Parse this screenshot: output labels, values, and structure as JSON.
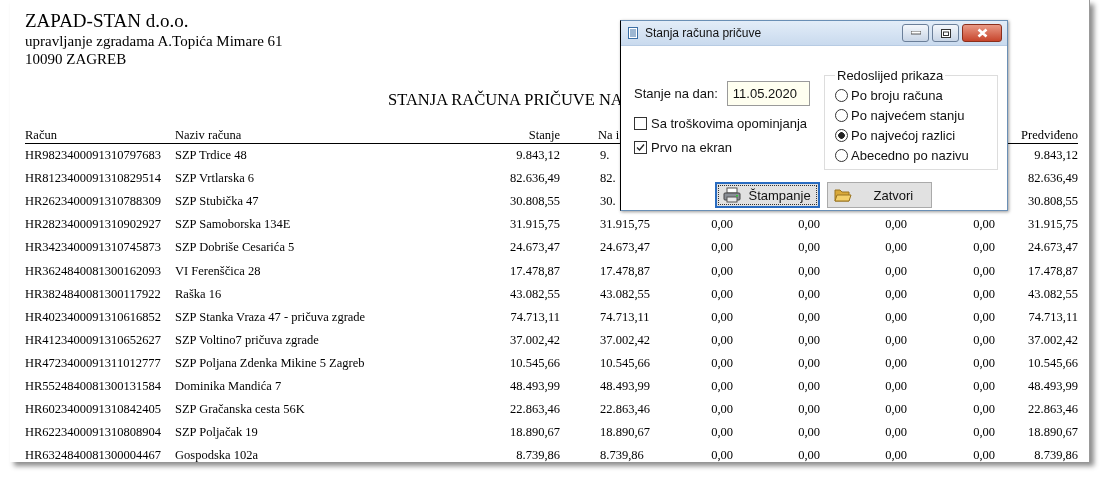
{
  "report": {
    "company": "ZAPAD-STAN d.o.o.",
    "address": "upravljanje zgradama A.Topića Mimare 61",
    "city": "10090 ZAGREB",
    "title": "STANJA RAČUNA PRIČUVE NA",
    "headers": {
      "account": "Račun",
      "name": "Naziv računa",
      "balance": "Stanje",
      "column_4": "Na i",
      "predicted": "Predviđeno"
    },
    "rows": [
      {
        "account": "HR9823400091310797683",
        "name": "SZP Trdice 48",
        "balance": "9.843,12",
        "column_4": "9.",
        "predicted": "9.843,12"
      },
      {
        "account": "HR8123400091310829514",
        "name": "SZP Vrtlarska 6",
        "balance": "82.636,49",
        "column_4": "82.",
        "predicted": "82.636,49"
      },
      {
        "account": "HR2623400091310788309",
        "name": "SZP Stubička 47",
        "balance": "30.808,55",
        "column_4": "30.",
        "predicted": "30.808,55"
      },
      {
        "account": "HR2823400091310902927",
        "name": "SZP Samoborska 134E",
        "balance": "31.915,75",
        "column_4": "31.915,75",
        "column_5": "0,00",
        "column_6": "0,00",
        "column_7": "0,00",
        "column_8": "0,00",
        "predicted": "31.915,75"
      },
      {
        "account": "HR3423400091310745873",
        "name": "SZP Dobriše Cesarića 5",
        "balance": "24.673,47",
        "column_4": "24.673,47",
        "column_5": "0,00",
        "column_6": "0,00",
        "column_7": "0,00",
        "column_8": "0,00",
        "predicted": "24.673,47"
      },
      {
        "account": "HR3624840081300162093",
        "name": "VI Ferenščica 28",
        "balance": "17.478,87",
        "column_4": "17.478,87",
        "column_5": "0,00",
        "column_6": "0,00",
        "column_7": "0,00",
        "column_8": "0,00",
        "predicted": "17.478,87"
      },
      {
        "account": "HR3824840081300117922",
        "name": "Raška 16",
        "balance": "43.082,55",
        "column_4": "43.082,55",
        "column_5": "0,00",
        "column_6": "0,00",
        "column_7": "0,00",
        "column_8": "0,00",
        "predicted": "43.082,55"
      },
      {
        "account": "HR4023400091310616852",
        "name": "SZP Stanka Vraza 47 - pričuva zgrade",
        "balance": "74.713,11",
        "column_4": "74.713,11",
        "column_5": "0,00",
        "column_6": "0,00",
        "column_7": "0,00",
        "column_8": "0,00",
        "predicted": "74.713,11"
      },
      {
        "account": "HR4123400091310652627",
        "name": "SZP Voltino7 pričuva zgrade",
        "balance": "37.002,42",
        "column_4": "37.002,42",
        "column_5": "0,00",
        "column_6": "0,00",
        "column_7": "0,00",
        "column_8": "0,00",
        "predicted": "37.002,42"
      },
      {
        "account": "HR4723400091311012777",
        "name": "SZP Poljana Zdenka Mikine 5 Zagreb",
        "balance": "10.545,66",
        "column_4": "10.545,66",
        "column_5": "0,00",
        "column_6": "0,00",
        "column_7": "0,00",
        "column_8": "0,00",
        "predicted": "10.545,66"
      },
      {
        "account": "HR5524840081300131584",
        "name": "Dominika Mandića 7",
        "balance": "48.493,99",
        "column_4": "48.493,99",
        "column_5": "0,00",
        "column_6": "0,00",
        "column_7": "0,00",
        "column_8": "0,00",
        "predicted": "48.493,99"
      },
      {
        "account": "HR6023400091310842405",
        "name": "SZP Gračanska cesta 56K",
        "balance": "22.863,46",
        "column_4": "22.863,46",
        "column_5": "0,00",
        "column_6": "0,00",
        "column_7": "0,00",
        "column_8": "0,00",
        "predicted": "22.863,46"
      },
      {
        "account": "HR6223400091310808904",
        "name": "SZP Poljačak 19",
        "balance": "18.890,67",
        "column_4": "18.890,67",
        "column_5": "0,00",
        "column_6": "0,00",
        "column_7": "0,00",
        "column_8": "0,00",
        "predicted": "18.890,67"
      },
      {
        "account": "HR6324840081300004467",
        "name": "Gospodska 102a",
        "balance": "8.739,86",
        "column_4": "8.739,86",
        "column_5": "0,00",
        "column_6": "0,00",
        "column_7": "0,00",
        "column_8": "0,00",
        "predicted": "8.739,86"
      }
    ]
  },
  "dialog": {
    "title": "Stanja računa pričuve",
    "date_label": "Stanje na dan:",
    "date_value": "11.05.2020",
    "checkboxes": [
      {
        "label": "Sa troškovima opominjanja",
        "checked": false
      },
      {
        "label": "Prvo na ekran",
        "checked": true
      }
    ],
    "order_group": {
      "title": "Redoslijed prikaza",
      "options": [
        {
          "label": "Po broju računa",
          "selected": false
        },
        {
          "label": "Po najvećem stanju",
          "selected": false
        },
        {
          "label": "Po najvećoj razlici",
          "selected": true
        },
        {
          "label": "Abecedno po nazivu",
          "selected": false
        }
      ]
    },
    "buttons": [
      {
        "label": "Štampanje",
        "kind": "print",
        "focused": true
      },
      {
        "label": "Zatvori",
        "kind": "folder",
        "focused": false
      }
    ]
  }
}
